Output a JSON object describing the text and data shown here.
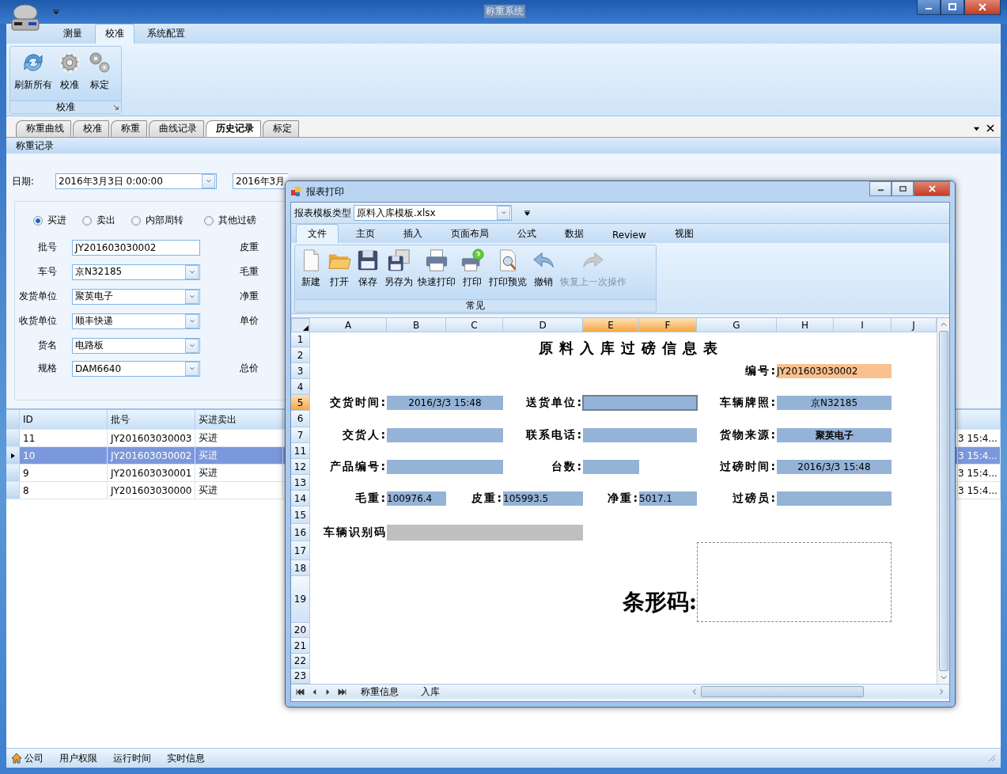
{
  "window": {
    "title": "称重系统"
  },
  "ribbon": {
    "tabs": [
      {
        "label": "测量",
        "selected": false
      },
      {
        "label": "校准",
        "selected": true
      },
      {
        "label": "系统配置",
        "selected": false
      }
    ],
    "groups": [
      {
        "label": "校准",
        "buttons": [
          {
            "label": "刷新所有",
            "kind": "refresh"
          },
          {
            "label": "校准",
            "kind": "gear"
          },
          {
            "label": "标定",
            "kind": "gears"
          }
        ]
      }
    ]
  },
  "doc_tabs": [
    {
      "label": "称重曲线",
      "selected": false
    },
    {
      "label": "校准",
      "selected": false
    },
    {
      "label": "称重",
      "selected": false
    },
    {
      "label": "曲线记录",
      "selected": false
    },
    {
      "label": "历史记录",
      "selected": true
    },
    {
      "label": "标定",
      "selected": false
    }
  ],
  "panel_title": "称重记录",
  "filter": {
    "date_label": "日期:",
    "date_from": "2016年3月3日 0:00:00",
    "date_to": "2016年3月"
  },
  "form": {
    "radios": [
      {
        "label": "买进",
        "selected": true
      },
      {
        "label": "卖出",
        "selected": false
      },
      {
        "label": "内部周转",
        "selected": false
      },
      {
        "label": "其他过磅",
        "selected": false
      }
    ],
    "fields": [
      {
        "label": "批号",
        "value": "JY201603030002",
        "kind": "text",
        "side_label": "皮重"
      },
      {
        "label": "车号",
        "value": "京N32185",
        "kind": "combo",
        "side_label": "毛重"
      },
      {
        "label": "发货单位",
        "value": "聚英电子",
        "kind": "combo",
        "side_label": "净重"
      },
      {
        "label": "收货单位",
        "value": "顺丰快递",
        "kind": "combo",
        "side_label": "单价"
      },
      {
        "label": "货名",
        "value": "电路板",
        "kind": "combo"
      },
      {
        "label": "规格",
        "value": "DAM6640",
        "kind": "combo",
        "side_label": "总价"
      }
    ]
  },
  "table": {
    "columns": [
      "ID",
      "批号",
      "买进卖出"
    ],
    "rows": [
      {
        "cells": [
          "11",
          "JY201603030003",
          "买进"
        ],
        "column_4": "3 15:4...",
        "selected": false
      },
      {
        "cells": [
          "10",
          "JY201603030002",
          "买进"
        ],
        "column_4": "3 15:4...",
        "selected": true
      },
      {
        "cells": [
          "9",
          "JY201603030001",
          "买进"
        ],
        "column_4": "3 15:4...",
        "selected": false
      },
      {
        "cells": [
          "8",
          "JY201603030000",
          "买进"
        ],
        "column_4": "3 15:4...",
        "selected": false
      }
    ]
  },
  "status_bar": {
    "items": [
      {
        "label": "公司",
        "kind": "home"
      },
      {
        "label": "用户权限",
        "kind": "text"
      },
      {
        "label": "运行时间",
        "kind": "text"
      },
      {
        "label": "实时信息",
        "kind": "text"
      }
    ]
  },
  "dialog": {
    "title": "报表打印",
    "template_label": "报表模板类型",
    "template_value": "原料入库模板.xlsx",
    "tabs": [
      {
        "label": "文件",
        "selected": true
      },
      {
        "label": "主页",
        "selected": false
      },
      {
        "label": "插入",
        "selected": false
      },
      {
        "label": "页面布局",
        "selected": false
      },
      {
        "label": "公式",
        "selected": false
      },
      {
        "label": "数据",
        "selected": false
      },
      {
        "label": "Review",
        "selected": false
      },
      {
        "label": "视图",
        "selected": false
      }
    ],
    "group": {
      "label": "常见",
      "buttons": [
        {
          "label": "新建",
          "kind": "new",
          "disabled": false
        },
        {
          "label": "打开",
          "kind": "open",
          "disabled": false
        },
        {
          "label": "保存",
          "kind": "save",
          "disabled": false
        },
        {
          "label": "另存为",
          "kind": "saveas",
          "disabled": false
        },
        {
          "label": "快速打印",
          "kind": "print",
          "disabled": false
        },
        {
          "label": "打印",
          "kind": "printq",
          "disabled": false
        },
        {
          "label": "打印预览",
          "kind": "preview",
          "disabled": false
        },
        {
          "label": "撤销",
          "kind": "undo",
          "disabled": false
        },
        {
          "label": "恢复上一次操作",
          "kind": "redo",
          "disabled": true
        }
      ]
    },
    "sheet": {
      "columns": [
        {
          "label": "A",
          "selected": false
        },
        {
          "label": "B",
          "selected": false
        },
        {
          "label": "C",
          "selected": false
        },
        {
          "label": "D",
          "selected": false
        },
        {
          "label": "E",
          "selected": true
        },
        {
          "label": "F",
          "selected": true
        },
        {
          "label": "G",
          "selected": false
        },
        {
          "label": "H",
          "selected": false
        },
        {
          "label": "I",
          "selected": false
        },
        {
          "label": "J",
          "selected": false
        }
      ],
      "rows": [
        {
          "label": "1",
          "selected": false
        },
        {
          "label": "2",
          "selected": false
        },
        {
          "label": "3",
          "selected": false
        },
        {
          "label": "4",
          "selected": false
        },
        {
          "label": "5",
          "selected": true
        },
        {
          "label": "6",
          "selected": false
        },
        {
          "label": "7",
          "selected": false
        },
        {
          "label": "11",
          "selected": false
        },
        {
          "label": "12",
          "selected": false
        },
        {
          "label": "13",
          "selected": false
        },
        {
          "label": "14",
          "selected": false
        },
        {
          "label": "15",
          "selected": false
        },
        {
          "label": "16",
          "selected": false
        },
        {
          "label": "17",
          "selected": false
        },
        {
          "label": "18",
          "selected": false
        },
        {
          "label": "19",
          "selected": false
        },
        {
          "label": "20",
          "selected": false
        },
        {
          "label": "21",
          "selected": false
        },
        {
          "label": "22",
          "selected": false
        },
        {
          "label": "23",
          "selected": false
        }
      ],
      "cells": [
        {
          "kind": "title",
          "text": "原料入库过磅信息表",
          "selected": false
        },
        {
          "kind": "label",
          "text": "编号:",
          "selected": false
        },
        {
          "kind": "value",
          "text": "JY201603030002",
          "color": "#fac090",
          "selected": false
        },
        {
          "kind": "label",
          "text": "交货时间:",
          "selected": false
        },
        {
          "kind": "value",
          "text": "2016/3/3 15:48",
          "color": "#95b3d7",
          "selected": false
        },
        {
          "kind": "label",
          "text": "送货单位:",
          "selected": false
        },
        {
          "kind": "value",
          "color": "#95b3d7",
          "selected": true
        },
        {
          "kind": "label",
          "text": "车辆牌照:",
          "selected": false
        },
        {
          "kind": "value",
          "text": "京N32185",
          "color": "#95b3d7",
          "selected": false
        },
        {
          "kind": "label",
          "text": "交货人:",
          "selected": false
        },
        {
          "kind": "value",
          "color": "#95b3d7",
          "selected": false
        },
        {
          "kind": "label",
          "text": "联系电话:",
          "selected": false
        },
        {
          "kind": "value",
          "color": "#95b3d7",
          "selected": false
        },
        {
          "kind": "label",
          "text": "货物来源:",
          "selected": false
        },
        {
          "kind": "value",
          "text": "聚英电子",
          "color": "#95b3d7",
          "selected": false
        },
        {
          "kind": "label",
          "text": "产品编号:",
          "selected": false
        },
        {
          "kind": "value",
          "color": "#95b3d7",
          "selected": false
        },
        {
          "kind": "label",
          "text": "台数:",
          "selected": false
        },
        {
          "kind": "value",
          "color": "#95b3d7",
          "selected": false
        },
        {
          "kind": "label",
          "text": "过磅时间:",
          "selected": false
        },
        {
          "kind": "value",
          "text": "2016/3/3 15:48",
          "color": "#95b3d7",
          "selected": false
        },
        {
          "kind": "label",
          "text": "毛重:",
          "selected": false
        },
        {
          "kind": "value",
          "text": "100976.4",
          "color": "#95b3d7",
          "selected": false
        },
        {
          "kind": "label",
          "text": "皮重:",
          "selected": false
        },
        {
          "kind": "value",
          "text": "105993.5",
          "color": "#95b3d7",
          "selected": false
        },
        {
          "kind": "label",
          "text": "净重:",
          "selected": false
        },
        {
          "kind": "value",
          "text": "5017.1",
          "color": "#95b3d7",
          "selected": false
        },
        {
          "kind": "label",
          "text": "过磅员:",
          "selected": false
        },
        {
          "kind": "value",
          "color": "#95b3d7",
          "selected": false
        },
        {
          "kind": "label",
          "text": "车辆识别码",
          "selected": false
        },
        {
          "kind": "value",
          "color": "#bfbfbf",
          "selected": false
        },
        {
          "kind": "big-label",
          "text": "条形码:",
          "selected": false
        },
        {
          "kind": "barcode",
          "selected": false
        }
      ]
    },
    "sheet_tabs": [
      "称重信息",
      "入库"
    ]
  }
}
